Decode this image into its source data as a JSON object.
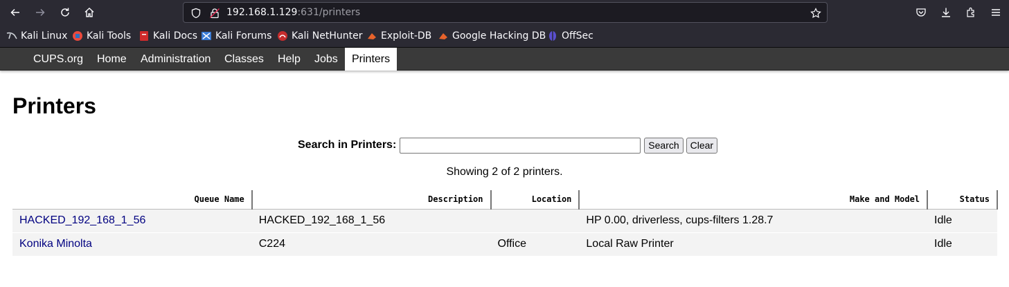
{
  "browser": {
    "url_host": "192.168.1.129",
    "url_rest": ":631/printers",
    "bookmarks": [
      {
        "label": "Kali Linux",
        "icon": "kali-dragon-icon"
      },
      {
        "label": "Kali Tools",
        "icon": "kali-tools-icon"
      },
      {
        "label": "Kali Docs",
        "icon": "kali-docs-icon"
      },
      {
        "label": "Kali Forums",
        "icon": "kali-forums-icon"
      },
      {
        "label": "Kali NetHunter",
        "icon": "nethunter-icon"
      },
      {
        "label": "Exploit-DB",
        "icon": "exploit-db-icon"
      },
      {
        "label": "Google Hacking DB",
        "icon": "ghdb-icon"
      },
      {
        "label": "OffSec",
        "icon": "offsec-icon"
      }
    ]
  },
  "cups_nav": [
    "CUPS.org",
    "Home",
    "Administration",
    "Classes",
    "Help",
    "Jobs",
    "Printers"
  ],
  "page": {
    "title": "Printers",
    "search_label": "Search in Printers:",
    "search_value": "",
    "search_button": "Search",
    "clear_button": "Clear",
    "showing": "Showing 2 of 2 printers."
  },
  "table": {
    "headers": [
      "Queue Name",
      "Description",
      "Location",
      "Make and Model",
      "Status"
    ],
    "rows": [
      {
        "queue": "HACKED_192_168_1_56",
        "description": "HACKED_192_168_1_56",
        "location": "",
        "model": "HP 0.00, driverless, cups-filters 1.28.7",
        "status": "Idle"
      },
      {
        "queue": "Konika Minolta",
        "description": "C224",
        "location": "Office",
        "model": "Local Raw Printer",
        "status": "Idle"
      }
    ]
  },
  "colors": {
    "chrome_bg": "#2b2a33",
    "cups_nav_bg": "#3a3a3a",
    "link": "#000080",
    "row_bg": "#f3f3f3"
  }
}
